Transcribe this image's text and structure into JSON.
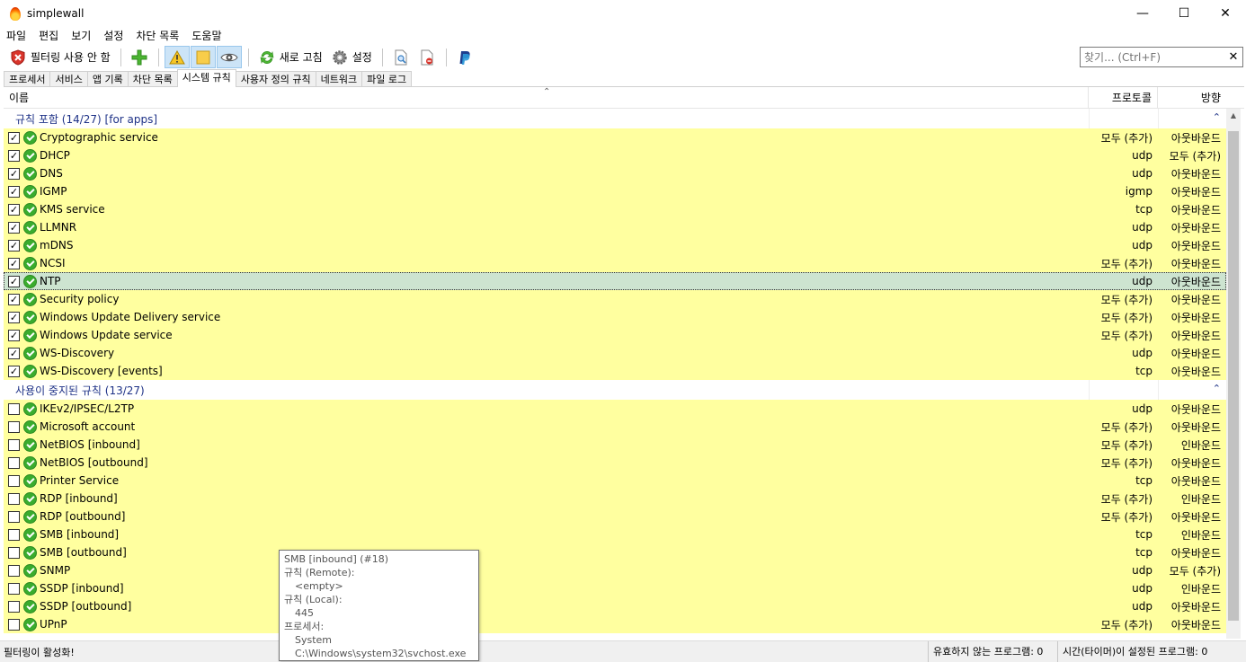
{
  "window": {
    "title": "simplewall"
  },
  "menu": [
    "파일",
    "편집",
    "보기",
    "설정",
    "차단 목록",
    "도움말"
  ],
  "toolbar": {
    "filter_label": "필터링 사용 안 함",
    "refresh_label": "새로 고침",
    "settings_label": "설정"
  },
  "search": {
    "placeholder": "찾기... (Ctrl+F)"
  },
  "tabs": [
    "프로세서",
    "서비스",
    "앱 기록",
    "차단 목록",
    "시스템 규칙",
    "사용자 정의 규칙",
    "네트워크",
    "파일 로그"
  ],
  "active_tab_index": 4,
  "columns": {
    "name": "이름",
    "protocol": "프로토콜",
    "direction": "방향"
  },
  "groups": [
    {
      "title": "규칙 포함 (14/27) [for apps]",
      "checked": true,
      "rows": [
        {
          "name": "Cryptographic service",
          "protocol": "모두 (추가)",
          "direction": "아웃바운드"
        },
        {
          "name": "DHCP",
          "protocol": "udp",
          "direction": "모두 (추가)"
        },
        {
          "name": "DNS",
          "protocol": "udp",
          "direction": "아웃바운드"
        },
        {
          "name": "IGMP",
          "protocol": "igmp",
          "direction": "아웃바운드"
        },
        {
          "name": "KMS service",
          "protocol": "tcp",
          "direction": "아웃바운드"
        },
        {
          "name": "LLMNR",
          "protocol": "udp",
          "direction": "아웃바운드"
        },
        {
          "name": "mDNS",
          "protocol": "udp",
          "direction": "아웃바운드"
        },
        {
          "name": "NCSI",
          "protocol": "모두 (추가)",
          "direction": "아웃바운드"
        },
        {
          "name": "NTP",
          "protocol": "udp",
          "direction": "아웃바운드",
          "selected": true
        },
        {
          "name": "Security policy",
          "protocol": "모두 (추가)",
          "direction": "아웃바운드"
        },
        {
          "name": "Windows Update Delivery service",
          "protocol": "모두 (추가)",
          "direction": "아웃바운드"
        },
        {
          "name": "Windows Update service",
          "protocol": "모두 (추가)",
          "direction": "아웃바운드"
        },
        {
          "name": "WS-Discovery",
          "protocol": "udp",
          "direction": "아웃바운드"
        },
        {
          "name": "WS-Discovery [events]",
          "protocol": "tcp",
          "direction": "아웃바운드"
        }
      ]
    },
    {
      "title": "사용이 중지된 규칙 (13/27)",
      "checked": false,
      "rows": [
        {
          "name": "IKEv2/IPSEC/L2TP",
          "protocol": "udp",
          "direction": "아웃바운드"
        },
        {
          "name": "Microsoft account",
          "protocol": "모두 (추가)",
          "direction": "아웃바운드"
        },
        {
          "name": "NetBIOS [inbound]",
          "protocol": "모두 (추가)",
          "direction": "인바운드"
        },
        {
          "name": "NetBIOS [outbound]",
          "protocol": "모두 (추가)",
          "direction": "아웃바운드"
        },
        {
          "name": "Printer Service",
          "protocol": "tcp",
          "direction": "아웃바운드"
        },
        {
          "name": "RDP [inbound]",
          "protocol": "모두 (추가)",
          "direction": "인바운드"
        },
        {
          "name": "RDP [outbound]",
          "protocol": "모두 (추가)",
          "direction": "아웃바운드"
        },
        {
          "name": "SMB [inbound]",
          "protocol": "tcp",
          "direction": "인바운드"
        },
        {
          "name": "SMB [outbound]",
          "protocol": "tcp",
          "direction": "아웃바운드"
        },
        {
          "name": "SNMP",
          "protocol": "udp",
          "direction": "모두 (추가)"
        },
        {
          "name": "SSDP [inbound]",
          "protocol": "udp",
          "direction": "인바운드"
        },
        {
          "name": "SSDP [outbound]",
          "protocol": "udp",
          "direction": "아웃바운드"
        },
        {
          "name": "UPnP",
          "protocol": "모두 (추가)",
          "direction": "아웃바운드"
        }
      ]
    }
  ],
  "tooltip": {
    "title": "SMB [inbound] (#18)",
    "remote_label": "규칙 (Remote):",
    "remote_value": "<empty>",
    "local_label": "규칙 (Local):",
    "local_value": "445",
    "process_label": "프로세서:",
    "process_name": "System",
    "process_path": "C:\\Windows\\system32\\svchost.exe"
  },
  "status": {
    "left": "필터링이 활성화!",
    "invalid": "유효하지 않는 프로그램: 0",
    "timers": "시간(타이머)이 설정된 프로그램: 0"
  },
  "colors": {
    "row_bg": "#ffff9f",
    "selected_bg": "#cde4d0",
    "group_text": "#1e3287",
    "check_ok": "#3aac2e"
  }
}
